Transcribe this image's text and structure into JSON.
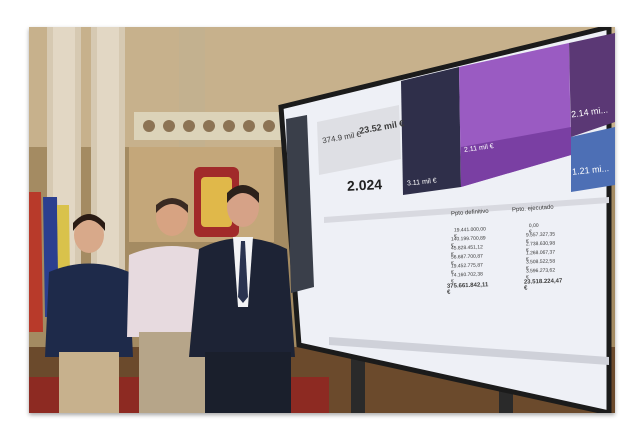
{
  "photo": {
    "screen": {
      "header_partial": "",
      "kpi_left": "374.9 mil €",
      "kpi_right": "23.52 mil €",
      "year": "2.024",
      "treemap_labels": [
        "2.14 mi...",
        "1.21 mi...",
        "3.11 mil €",
        "2.11 mil €"
      ],
      "table_headers": [
        "Ppto definitivo",
        "Ppto. ejecutado"
      ],
      "table_rows": [
        [
          "19.441.000,00 €",
          "0,00 €"
        ],
        [
          "140.199.700,89 €",
          "9.557.327,35 €"
        ],
        [
          "45.828.451,12 €",
          "2.738.630,98 €"
        ],
        [
          "56.687.700,87 €",
          "1.268.067,37 €"
        ],
        [
          "19.452.775,87 €",
          "3.508.522,58 €"
        ],
        [
          "74.160.702,38 €",
          "3.596.273,62 €"
        ]
      ],
      "table_totals": [
        "375.661.842,11 €",
        "23.518.224,47 €"
      ]
    },
    "colors": {
      "treemap_dark": "#2f2f4a",
      "treemap_purple": "#9a5bc2",
      "treemap_blue": "#4d6fb5",
      "suit_dark": "#1d2335",
      "shirt_light": "#e7dadf"
    }
  }
}
